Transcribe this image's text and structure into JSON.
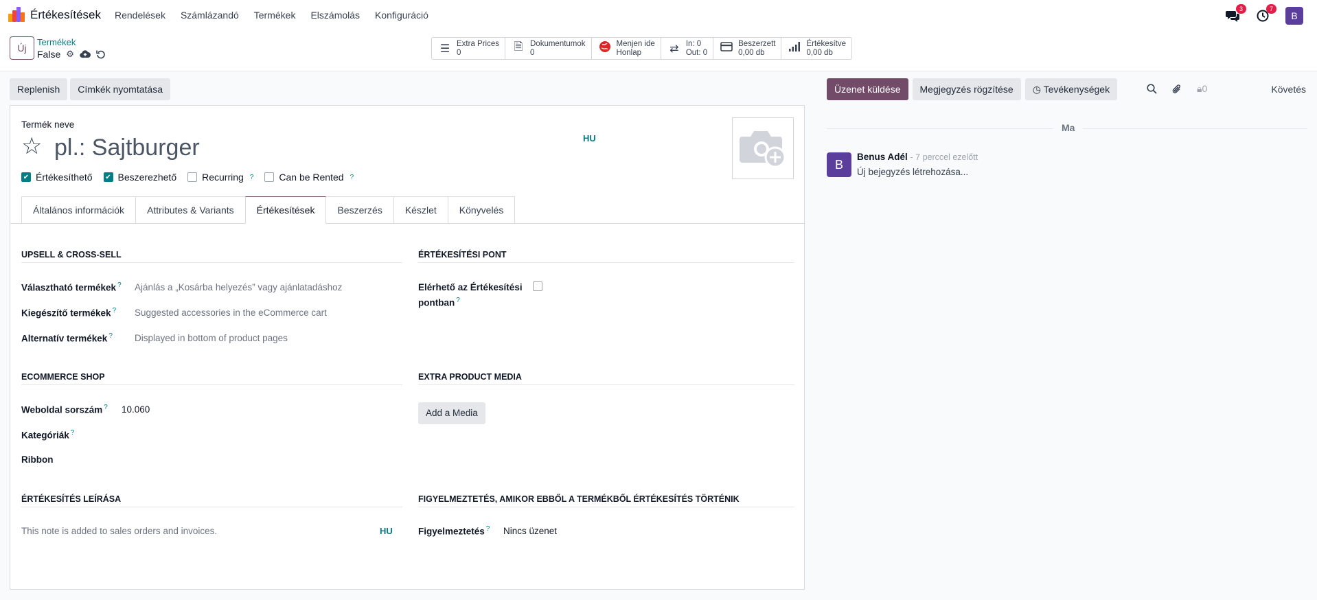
{
  "topbar": {
    "app_name": "Értékesítések",
    "menu": [
      "Rendelések",
      "Számlázandó",
      "Termékek",
      "Elszámolás",
      "Konfiguráció"
    ],
    "messages_badge": "3",
    "activities_badge": "7",
    "user_initial": "B",
    "colors": {
      "accent": "#714b67",
      "link": "#017e84",
      "badge": "#e11d48",
      "avatar": "#5b3d9c"
    }
  },
  "control_panel": {
    "new_button": "Új",
    "breadcrumb_parent": "Termékek",
    "breadcrumb_current": "False",
    "smart_buttons": [
      {
        "icon": "list-icon",
        "line1": "Extra Prices",
        "line2": "0"
      },
      {
        "icon": "document-icon",
        "line1": "Dokumentumok",
        "line2": "0"
      },
      {
        "icon": "globe-icon",
        "line1": "Menjen ide",
        "line2": "Honlap"
      },
      {
        "icon": "transfer-icon",
        "line1": "In: 0",
        "line2": "Out: 0"
      },
      {
        "icon": "credit-card-icon",
        "line1": "Beszerzett",
        "line2": "0,00 db"
      },
      {
        "icon": "bar-chart-icon",
        "line1": "Értékesítve",
        "line2": "0,00 db"
      }
    ]
  },
  "actions": {
    "replenish": "Replenish",
    "print_labels": "Címkék nyomtatása"
  },
  "form": {
    "name_label": "Termék neve",
    "name_placeholder": "pl.: Sajtburger",
    "lang": "HU",
    "checkboxes": [
      {
        "label": "Értékesíthető",
        "checked": true,
        "help": false
      },
      {
        "label": "Beszerezhető",
        "checked": true,
        "help": false
      },
      {
        "label": "Recurring",
        "checked": false,
        "help": true
      },
      {
        "label": "Can be Rented",
        "checked": false,
        "help": true
      }
    ],
    "help_mark": "?",
    "tabs": [
      "Általános információk",
      "Attributes & Variants",
      "Értékesítések",
      "Beszerzés",
      "Készlet",
      "Könyvelés"
    ],
    "active_tab": "Értékesítések",
    "upsell": {
      "title": "UPSELL & CROSS-SELL",
      "optional_label": "Választható termékek",
      "optional_ph": "Ajánlás a „Kosárba helyezés” vagy ajánlatadáshoz",
      "accessory_label": "Kiegészítő termékek",
      "accessory_ph": "Suggested accessories in the eCommerce cart",
      "alternative_label": "Alternatív termékek",
      "alternative_ph": "Displayed in bottom of product pages"
    },
    "pos": {
      "title": "ÉRTÉKESÍTÉSI PONT",
      "available_label_1": "Elérhető az Értékesítési",
      "available_label_2": "pontban"
    },
    "ecommerce": {
      "title": "ECOMMERCE SHOP",
      "sequence_label": "Weboldal sorszám",
      "sequence_value": "10.060",
      "categories_label": "Kategóriák",
      "ribbon_label": "Ribbon"
    },
    "media": {
      "title": "EXTRA PRODUCT MEDIA",
      "add_button": "Add a Media"
    },
    "sales_desc": {
      "title": "ÉRTÉKESÍTÉS LEÍRÁSA",
      "placeholder": "This note is added to sales orders and invoices.",
      "lang": "HU"
    },
    "warning": {
      "title": "FIGYELMEZTETÉS, AMIKOR EBBŐL A TERMÉKBŐL ÉRTÉKESÍTÉS TÖRTÉNIK",
      "label": "Figyelmeztetés",
      "value": "Nincs üzenet"
    }
  },
  "chatter": {
    "send_message": "Üzenet küldése",
    "log_note": "Megjegyzés rögzítése",
    "activities": "Tevékenységek",
    "followers_count": "0",
    "follow": "Követés",
    "day": "Ma",
    "message": {
      "initial": "B",
      "author": "Benus Adél",
      "time": "- 7 perccel ezelőtt",
      "body": "Új bejegyzés létrehozása..."
    }
  }
}
